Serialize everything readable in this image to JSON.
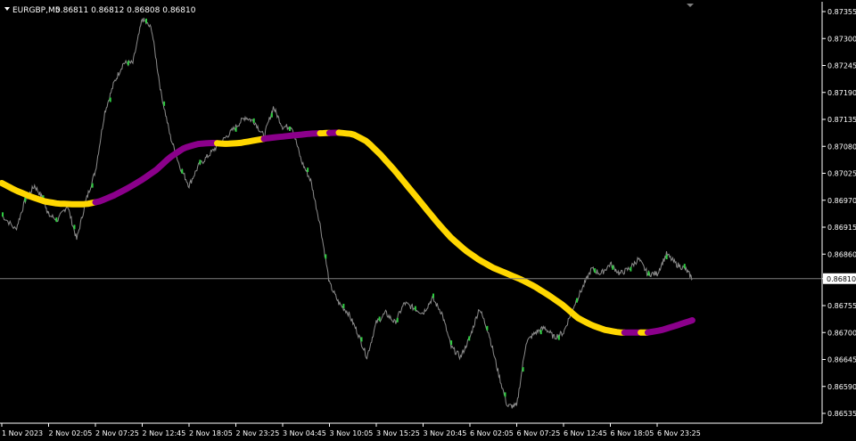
{
  "header": {
    "symbol": "EURGBP,M5",
    "ohlc": "0.86811 0.86812 0.86808 0.86810"
  },
  "price_axis": {
    "ticks": [
      "0.87355",
      "0.87300",
      "0.87245",
      "0.87190",
      "0.87135",
      "0.87080",
      "0.87025",
      "0.86970",
      "0.86915",
      "0.86860",
      "0.86810",
      "0.86755",
      "0.86700",
      "0.86645",
      "0.86590",
      "0.86535"
    ],
    "current_price_label": "0.86810",
    "current_price": 0.8681
  },
  "time_axis": {
    "labels": [
      "1 Nov 2023",
      "2 Nov 02:05",
      "2 Nov 07:25",
      "2 Nov 12:45",
      "2 Nov 18:05",
      "2 Nov 23:25",
      "3 Nov 04:45",
      "3 Nov 10:05",
      "3 Nov 15:25",
      "3 Nov 20:45",
      "6 Nov 02:05",
      "6 Nov 07:25",
      "6 Nov 12:45",
      "6 Nov 18:05",
      "6 Nov 23:25"
    ]
  },
  "colors": {
    "background": "#000000",
    "price_line": "#8c8c8c",
    "bull_tick": "#2ecc40",
    "ma_up": "#ffd700",
    "ma_down": "#8b008b",
    "axis_line": "#ffffff",
    "grid": "#7f7f7f"
  },
  "chart_data": {
    "type": "line",
    "symbol": "EURGBP",
    "timeframe": "M5",
    "ylim": [
      0.86515,
      0.87375
    ],
    "x_labels": [
      "1 Nov 2023",
      "2 Nov 02:05",
      "2 Nov 07:25",
      "2 Nov 12:45",
      "2 Nov 18:05",
      "2 Nov 23:25",
      "3 Nov 04:45",
      "3 Nov 10:05",
      "3 Nov 15:25",
      "3 Nov 20:45",
      "6 Nov 02:05",
      "6 Nov 07:25",
      "6 Nov 12:45",
      "6 Nov 18:05",
      "6 Nov 23:25"
    ],
    "series": [
      {
        "style": "price",
        "x": [
          0,
          0.3,
          0.5,
          0.7,
          0.9,
          1.0,
          1.2,
          1.4,
          1.6,
          1.8,
          2.0,
          2.2,
          2.4,
          2.6,
          2.8,
          3.0,
          3.2,
          3.4,
          3.6,
          3.8,
          4.0,
          4.2,
          4.4,
          4.6,
          4.8,
          5.0,
          5.2,
          5.4,
          5.6,
          5.8,
          6.0,
          6.2,
          6.4,
          6.6,
          6.8,
          7.0,
          7.2,
          7.4,
          7.6,
          7.8,
          8.0,
          8.2,
          8.4,
          8.6,
          8.8,
          9.0,
          9.2,
          9.4,
          9.6,
          9.8,
          10.0,
          10.2,
          10.4,
          10.6,
          10.8,
          11.0,
          11.2,
          11.4,
          11.6,
          11.8,
          12.0,
          12.2,
          12.4,
          12.6,
          12.8,
          13.0,
          13.2,
          13.4,
          13.6,
          13.8,
          14.0,
          14.2,
          14.4,
          14.6,
          14.75
        ],
        "y": [
          0.8694,
          0.8691,
          0.8697,
          0.87,
          0.8697,
          0.8694,
          0.8693,
          0.8696,
          0.8689,
          0.8697,
          0.8703,
          0.8715,
          0.8721,
          0.8725,
          0.8725,
          0.8734,
          0.8732,
          0.8719,
          0.871,
          0.8704,
          0.87,
          0.8704,
          0.8706,
          0.8708,
          0.871,
          0.8712,
          0.8714,
          0.8713,
          0.871,
          0.8716,
          0.8712,
          0.8712,
          0.8705,
          0.8701,
          0.8692,
          0.868,
          0.8676,
          0.8674,
          0.867,
          0.8665,
          0.8672,
          0.8674,
          0.8672,
          0.8676,
          0.8675,
          0.8674,
          0.8677,
          0.8674,
          0.8667,
          0.8665,
          0.8669,
          0.8675,
          0.867,
          0.8662,
          0.8655,
          0.8655,
          0.8668,
          0.867,
          0.8671,
          0.8669,
          0.867,
          0.8675,
          0.8679,
          0.8683,
          0.8682,
          0.8684,
          0.8682,
          0.8683,
          0.8685,
          0.8682,
          0.8682,
          0.8686,
          0.8684,
          0.8683,
          0.8681
        ]
      },
      {
        "style": "moving-average",
        "x": [
          0,
          0.3,
          0.6,
          0.9,
          1.2,
          1.5,
          1.8,
          2.1,
          2.4,
          2.7,
          3.0,
          3.3,
          3.6,
          3.9,
          4.2,
          4.5,
          4.8,
          5.1,
          5.4,
          5.7,
          6.0,
          6.3,
          6.6,
          6.9,
          7.2,
          7.5,
          7.8,
          8.1,
          8.4,
          8.7,
          9.0,
          9.3,
          9.6,
          9.9,
          10.2,
          10.5,
          10.8,
          11.1,
          11.4,
          11.7,
          12.0,
          12.3,
          12.6,
          12.9,
          13.2,
          13.5,
          13.8,
          14.1,
          14.4,
          14.75
        ],
        "y": [
          0.87005,
          0.8699,
          0.86978,
          0.86968,
          0.86963,
          0.86962,
          0.86962,
          0.86968,
          0.8698,
          0.86995,
          0.87012,
          0.87032,
          0.87058,
          0.87077,
          0.87085,
          0.87087,
          0.87085,
          0.87087,
          0.87092,
          0.87097,
          0.871,
          0.87103,
          0.87106,
          0.87107,
          0.87108,
          0.87105,
          0.8709,
          0.87062,
          0.8703,
          0.86995,
          0.8696,
          0.86925,
          0.86893,
          0.86868,
          0.86848,
          0.86832,
          0.8682,
          0.86808,
          0.86793,
          0.86775,
          0.86755,
          0.8673,
          0.86715,
          0.86705,
          0.867,
          0.867,
          0.867,
          0.86705,
          0.86714,
          0.86725
        ],
        "segments": [
          {
            "color": "#ffd700",
            "from": 0,
            "to": 2.0
          },
          {
            "color": "#8b008b",
            "from": 2.0,
            "to": 4.6
          },
          {
            "color": "#ffd700",
            "from": 4.6,
            "to": 5.6
          },
          {
            "color": "#8b008b",
            "from": 5.6,
            "to": 6.8
          },
          {
            "color": "#ffd700",
            "from": 6.8,
            "to": 7.0
          },
          {
            "color": "#8b008b",
            "from": 7.0,
            "to": 7.2
          },
          {
            "color": "#ffd700",
            "from": 7.2,
            "to": 13.3
          },
          {
            "color": "#8b008b",
            "from": 13.3,
            "to": 13.65
          },
          {
            "color": "#ffd700",
            "from": 13.65,
            "to": 13.8
          },
          {
            "color": "#8b008b",
            "from": 13.8,
            "to": 14.75
          }
        ]
      }
    ]
  }
}
